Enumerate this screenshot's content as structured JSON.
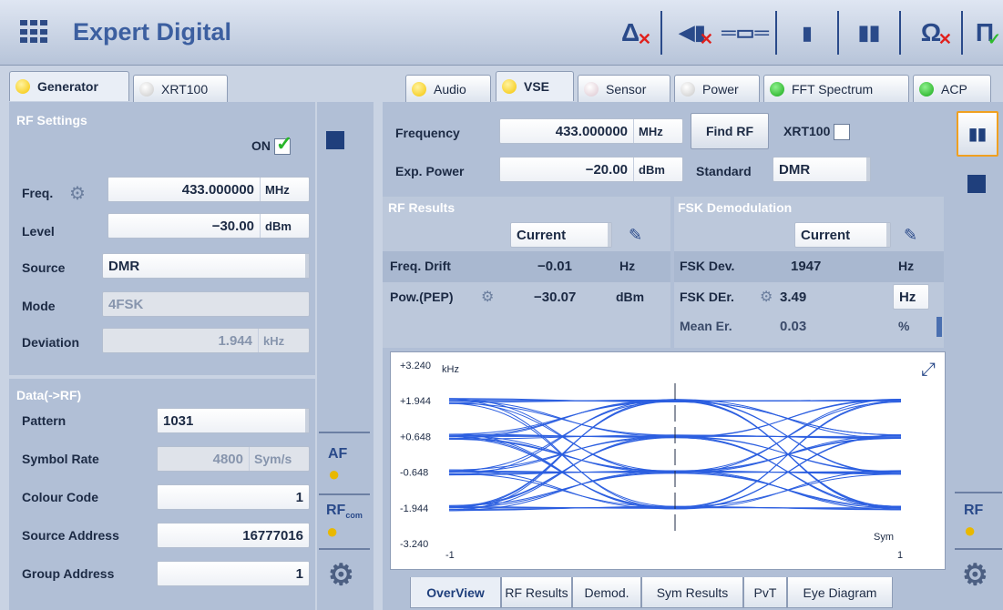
{
  "app": {
    "title": "Expert Digital"
  },
  "toolbar": {
    "delta": "Δ",
    "mute": "🔇",
    "signal": "⇥",
    "clip": "▮",
    "bars": "▮▮",
    "ohm": "Ω",
    "pi": "Π"
  },
  "left_tabs": [
    {
      "label": "Generator",
      "dot": "yellow"
    },
    {
      "label": "XRT100",
      "dot": "grey"
    }
  ],
  "rf_settings": {
    "title": "RF Settings",
    "on_label": "ON",
    "freq": {
      "label": "Freq.",
      "value": "433.000000",
      "unit": "MHz"
    },
    "level": {
      "label": "Level",
      "value": "−30.00",
      "unit": "dBm"
    },
    "source": {
      "label": "Source",
      "value": "DMR"
    },
    "mode": {
      "label": "Mode",
      "value": "4FSK"
    },
    "deviation": {
      "label": "Deviation",
      "value": "1.944",
      "unit": "kHz"
    }
  },
  "data_rf": {
    "title": "Data(->RF)",
    "pattern": {
      "label": "Pattern",
      "value": "1031"
    },
    "symbol_rate": {
      "label": "Symbol Rate",
      "value": "4800",
      "unit": "Sym/s"
    },
    "colour_code": {
      "label": "Colour Code",
      "value": "1"
    },
    "source_address": {
      "label": "Source Address",
      "value": "16777016"
    },
    "group_address": {
      "label": "Group Address",
      "value": "1"
    }
  },
  "left_side": {
    "af": "AF",
    "rf": "RF",
    "rf_sub": "com"
  },
  "right_tabs": [
    {
      "label": "Audio",
      "dot": "yellow"
    },
    {
      "label": "VSE",
      "dot": "yellow"
    },
    {
      "label": "Sensor",
      "dot": "pink"
    },
    {
      "label": "Power",
      "dot": "grey"
    },
    {
      "label": "FFT Spectrum",
      "dot": "green"
    },
    {
      "label": "ACP",
      "dot": "green"
    }
  ],
  "vse": {
    "frequency": {
      "label": "Frequency",
      "value": "433.000000",
      "unit": "MHz"
    },
    "exp_power": {
      "label": "Exp. Power",
      "value": "−20.00",
      "unit": "dBm"
    },
    "find_rf": "Find RF",
    "xrt100": "XRT100",
    "standard": {
      "label": "Standard",
      "value": "DMR"
    }
  },
  "rf_results": {
    "title": "RF Results",
    "mode": "Current",
    "rows": [
      {
        "label": "Freq. Drift",
        "value": "−0.01",
        "unit": "Hz"
      },
      {
        "label": "Pow.(PEP)",
        "value": "−30.07",
        "unit": "dBm"
      }
    ]
  },
  "fsk_demod": {
    "title": "FSK Demodulation",
    "mode": "Current",
    "rows": [
      {
        "label": "FSK Dev.",
        "value": "1947",
        "unit": "Hz"
      },
      {
        "label": "FSK DEr.",
        "value": "3.49",
        "unit": "Hz"
      },
      {
        "label": "Mean Er.",
        "value": "0.03",
        "unit": "%"
      }
    ]
  },
  "chart_data": {
    "type": "line",
    "title": "",
    "y_unit": "kHz",
    "x_unit": "Sym",
    "x_ticks": [
      "-1",
      "1"
    ],
    "y_ticks": [
      "+3.240",
      "+1.944",
      "+0.648",
      "-0.648",
      "-1.944",
      "-3.240"
    ],
    "xlim": [
      -1,
      1
    ],
    "ylim": [
      -3.24,
      3.24
    ],
    "symbol_levels": [
      1.944,
      0.648,
      -0.648,
      -1.944
    ],
    "line_color": "#2c5fe0"
  },
  "bottom_tabs": [
    "OverView",
    "RF Results",
    "Demod.",
    "Sym Results",
    "PvT",
    "Eye Diagram"
  ],
  "right_side": {
    "rf": "RF"
  }
}
